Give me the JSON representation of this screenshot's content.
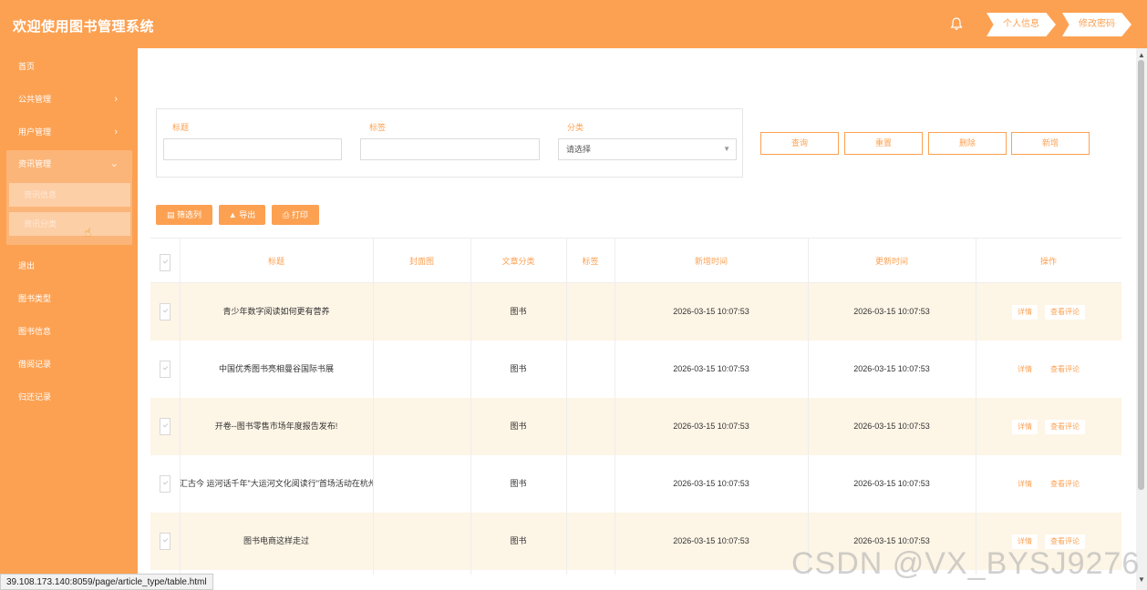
{
  "header": {
    "title": "欢迎使用图书管理系统",
    "buttons": {
      "profile": "个人信息",
      "password": "修改密码"
    }
  },
  "sidebar": {
    "home": "首页",
    "items": [
      {
        "label": "公共管理",
        "chevron": "›"
      },
      {
        "label": "用户管理",
        "chevron": "›"
      }
    ],
    "expanded": {
      "label": "资讯管理",
      "chevron": "⌄",
      "children": [
        "资讯信息",
        "资讯分类"
      ]
    },
    "rest": [
      "退出",
      "图书类型",
      "图书信息",
      "借阅记录",
      "归还记录"
    ]
  },
  "search": {
    "title_label": "标题",
    "tag_label": "标签",
    "category_label": "分类",
    "category_placeholder": "请选择",
    "buttons": {
      "query": "查询",
      "reset": "重置",
      "delete": "删除",
      "add": "新增"
    }
  },
  "toolbar": {
    "columns": "筛选列",
    "export": "导出",
    "print": "打印"
  },
  "table": {
    "columns": [
      "标题",
      "封面图",
      "文章分类",
      "标签",
      "新增时间",
      "更新时间",
      "操作"
    ],
    "actions": {
      "detail": "详情",
      "comments": "查看评论"
    },
    "rows": [
      {
        "title": "青少年数字阅读如何更有营养",
        "cover": "",
        "category": "图书",
        "tag": "",
        "created": "2026-03-15 10:07:53",
        "updated": "2026-03-15 10:07:53"
      },
      {
        "title": "中国优秀图书亮相曼谷国际书展",
        "cover": "",
        "category": "图书",
        "tag": "",
        "created": "2026-03-15 10:07:53",
        "updated": "2026-03-15 10:07:53"
      },
      {
        "title": "开卷--图书零售市场年度报告发布!",
        "cover": "",
        "category": "图书",
        "tag": "",
        "created": "2026-03-15 10:07:53",
        "updated": "2026-03-15 10:07:53"
      },
      {
        "title": "汇古今 运河话千年\"大运河文化阅读行\"首场活动在杭州",
        "cover": "",
        "category": "图书",
        "tag": "",
        "created": "2026-03-15 10:07:53",
        "updated": "2026-03-15 10:07:53"
      },
      {
        "title": "图书电商这样走过",
        "cover": "",
        "category": "图书",
        "tag": "",
        "created": "2026-03-15 10:07:53",
        "updated": "2026-03-15 10:07:53"
      }
    ]
  },
  "statusbar": {
    "url": "39.108.173.140:8059/page/article_type/table.html"
  },
  "watermark": "CSDN @VX_BYSJ9276",
  "colors": {
    "accent": "#fca152",
    "row_highlight": "#fdf5e6"
  },
  "icons": {
    "bell": "bell-icon",
    "columns": "table-icon",
    "export": "upload-icon",
    "print": "printer-icon"
  }
}
